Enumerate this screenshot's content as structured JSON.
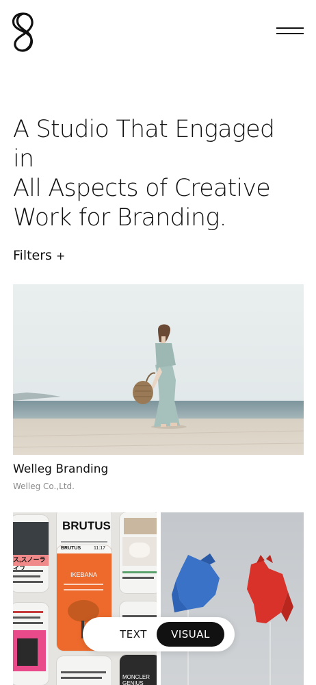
{
  "header": {
    "logo_icon": "s-monogram-logo-icon",
    "menu_icon": "hamburger-menu-icon"
  },
  "hero": {
    "line1": "A Studio That Engaged in",
    "line2": "All Aspects of Creative",
    "line3": "Work for Branding."
  },
  "filters": {
    "label": "Filters",
    "icon": "+"
  },
  "projects": [
    {
      "title": "Welleg Branding",
      "client": "Welleg Co.,Ltd."
    }
  ],
  "card2": {
    "magazine_name": "BRUTUS",
    "phone_small_brand": "BRUTUS",
    "phone_time": "11:17",
    "phone_orange_heading": "IKEBANA",
    "left_strip_text": "ス,スノーライフ",
    "bottom_caption": "MONCLER GENIUS"
  },
  "toggle": {
    "text_label": "TEXT",
    "visual_label": "VISUAL",
    "active": "visual"
  },
  "colors": {
    "accent": "#111111",
    "background": "#ffffff",
    "muted": "#8a8a8a",
    "orange_panel": "#ee6a2c"
  }
}
